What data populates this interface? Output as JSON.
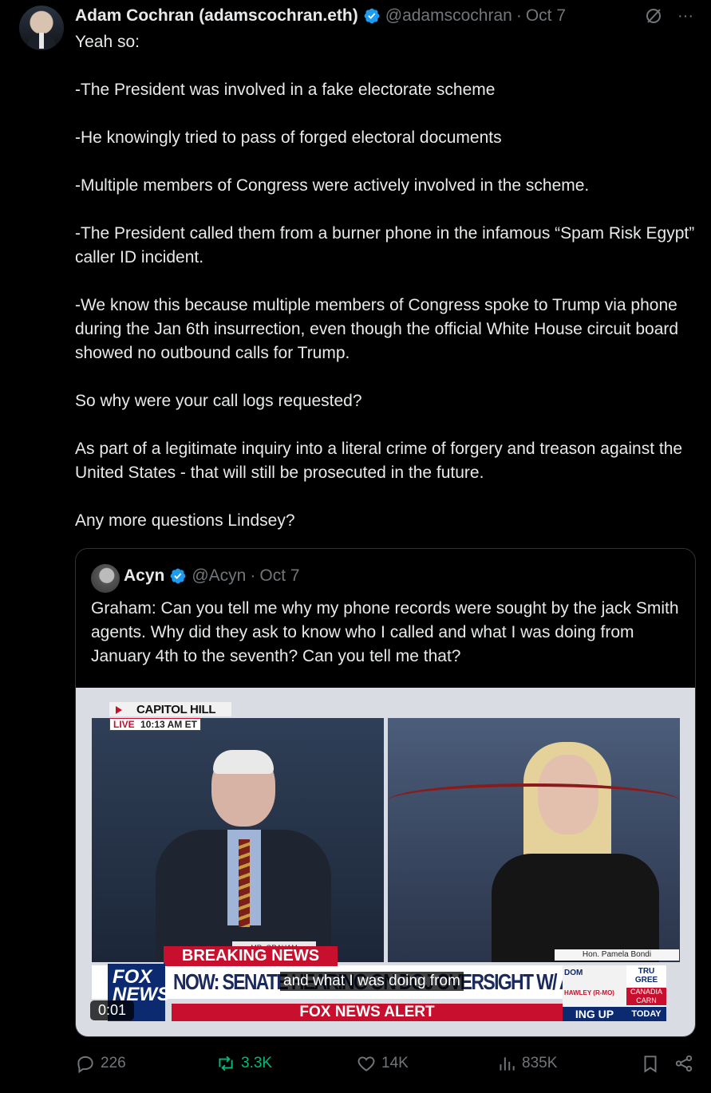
{
  "tweet": {
    "author_name": "Adam Cochran (adamscochran.eth)",
    "handle": "@adamscochran",
    "separator": "·",
    "date": "Oct 7",
    "text": "Yeah so:\n\n-The President was involved in a fake electorate scheme\n\n-He knowingly tried to pass of forged electoral documents\n\n-Multiple members of Congress were actively involved in the scheme.\n\n-The President called them from a burner phone in the infamous “Spam Risk Egypt” caller ID incident.\n\n-We know this because multiple members of Congress spoke to Trump via phone during the Jan 6th insurrection, even though the official White House circuit board showed no outbound calls for Trump.\n\nSo why were your call logs requested?\n\nAs part of a legitimate inquiry into a literal crime of forgery and treason against the United States - that will still be prosecuted in the future.\n\nAny more questions Lindsey?",
    "more_label": "···"
  },
  "quote": {
    "author_name": "Acyn",
    "handle": "@Acyn",
    "separator": "·",
    "date": "Oct 7",
    "text": "Graham: Can you tell me why my phone records were sought by the jack Smith agents. Why did they ask to know who I called and what I was doing from January 4th to the seventh? Can you tell me that?",
    "video": {
      "location_tag": "CAPITOL HILL",
      "live_label": "LIVE",
      "live_time": "10:13 AM ET",
      "nameplate_left": "MR. GRAHAM",
      "nameplate_right": "Hon. Pamela Bondi",
      "breaking_label": "BREAKING NEWS",
      "headline": "NOW: SENATE HEARING ON DOJ OVERSIGHT W/ AG BONDI",
      "network_logo": "FOX NEWS",
      "alert_label": "FOX NEWS ALERT",
      "side_top": "DOM",
      "side_mid": "HAWLEY (R-MO)",
      "side_bottom": "ING UP",
      "side2_top": "TRU GREE",
      "side2_mid": "CANADIA CARN",
      "side2_bottom": "TODAY",
      "subtitle": "and what I was doing from",
      "timer": "0:01"
    }
  },
  "actions": {
    "replies": "226",
    "reposts": "3.3K",
    "likes": "14K",
    "views": "835K"
  },
  "colors": {
    "background": "#000000",
    "text": "#e7e9ea",
    "muted": "#71767b",
    "verified": "#1d9bf0",
    "repost_active": "#00ba7c"
  }
}
